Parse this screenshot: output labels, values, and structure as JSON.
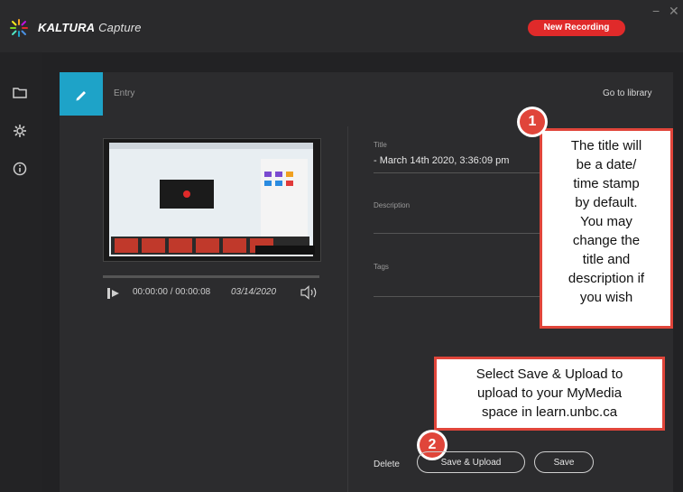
{
  "app": {
    "brand_bold": "KALTURA",
    "brand_rest": " Capture",
    "new_recording": "New Recording",
    "minimize": "−",
    "close": "✕"
  },
  "sidebar": {
    "items": [
      {
        "icon": "folder-icon"
      },
      {
        "icon": "gear-icon"
      },
      {
        "icon": "info-icon"
      }
    ]
  },
  "entry": {
    "tab_label": "Entry",
    "goto_library": "Go to library"
  },
  "player": {
    "time": "00:00:00 / 00:00:08",
    "date": "03/14/2020"
  },
  "form": {
    "title_label": "Title",
    "title_value": "- March 14th 2020, 3:36:09 pm",
    "description_label": "Description",
    "tags_label": "Tags"
  },
  "annotations": {
    "badge1": "1",
    "callout1_lines": [
      "The title will",
      "be a date/",
      "time stamp",
      "by default.",
      "You may",
      "change the",
      "title and",
      "description if",
      "you wish"
    ],
    "badge2": "2",
    "callout2_lines": [
      "Select Save & Upload to",
      "upload to your MyMedia",
      "space in learn.unbc.ca"
    ]
  },
  "actions": {
    "delete": "Delete",
    "save_upload": "Save & Upload",
    "save": "Save"
  },
  "colors": {
    "accent": "#1ea3c8",
    "record": "#e02a2a",
    "callout_border": "#e0453a"
  }
}
